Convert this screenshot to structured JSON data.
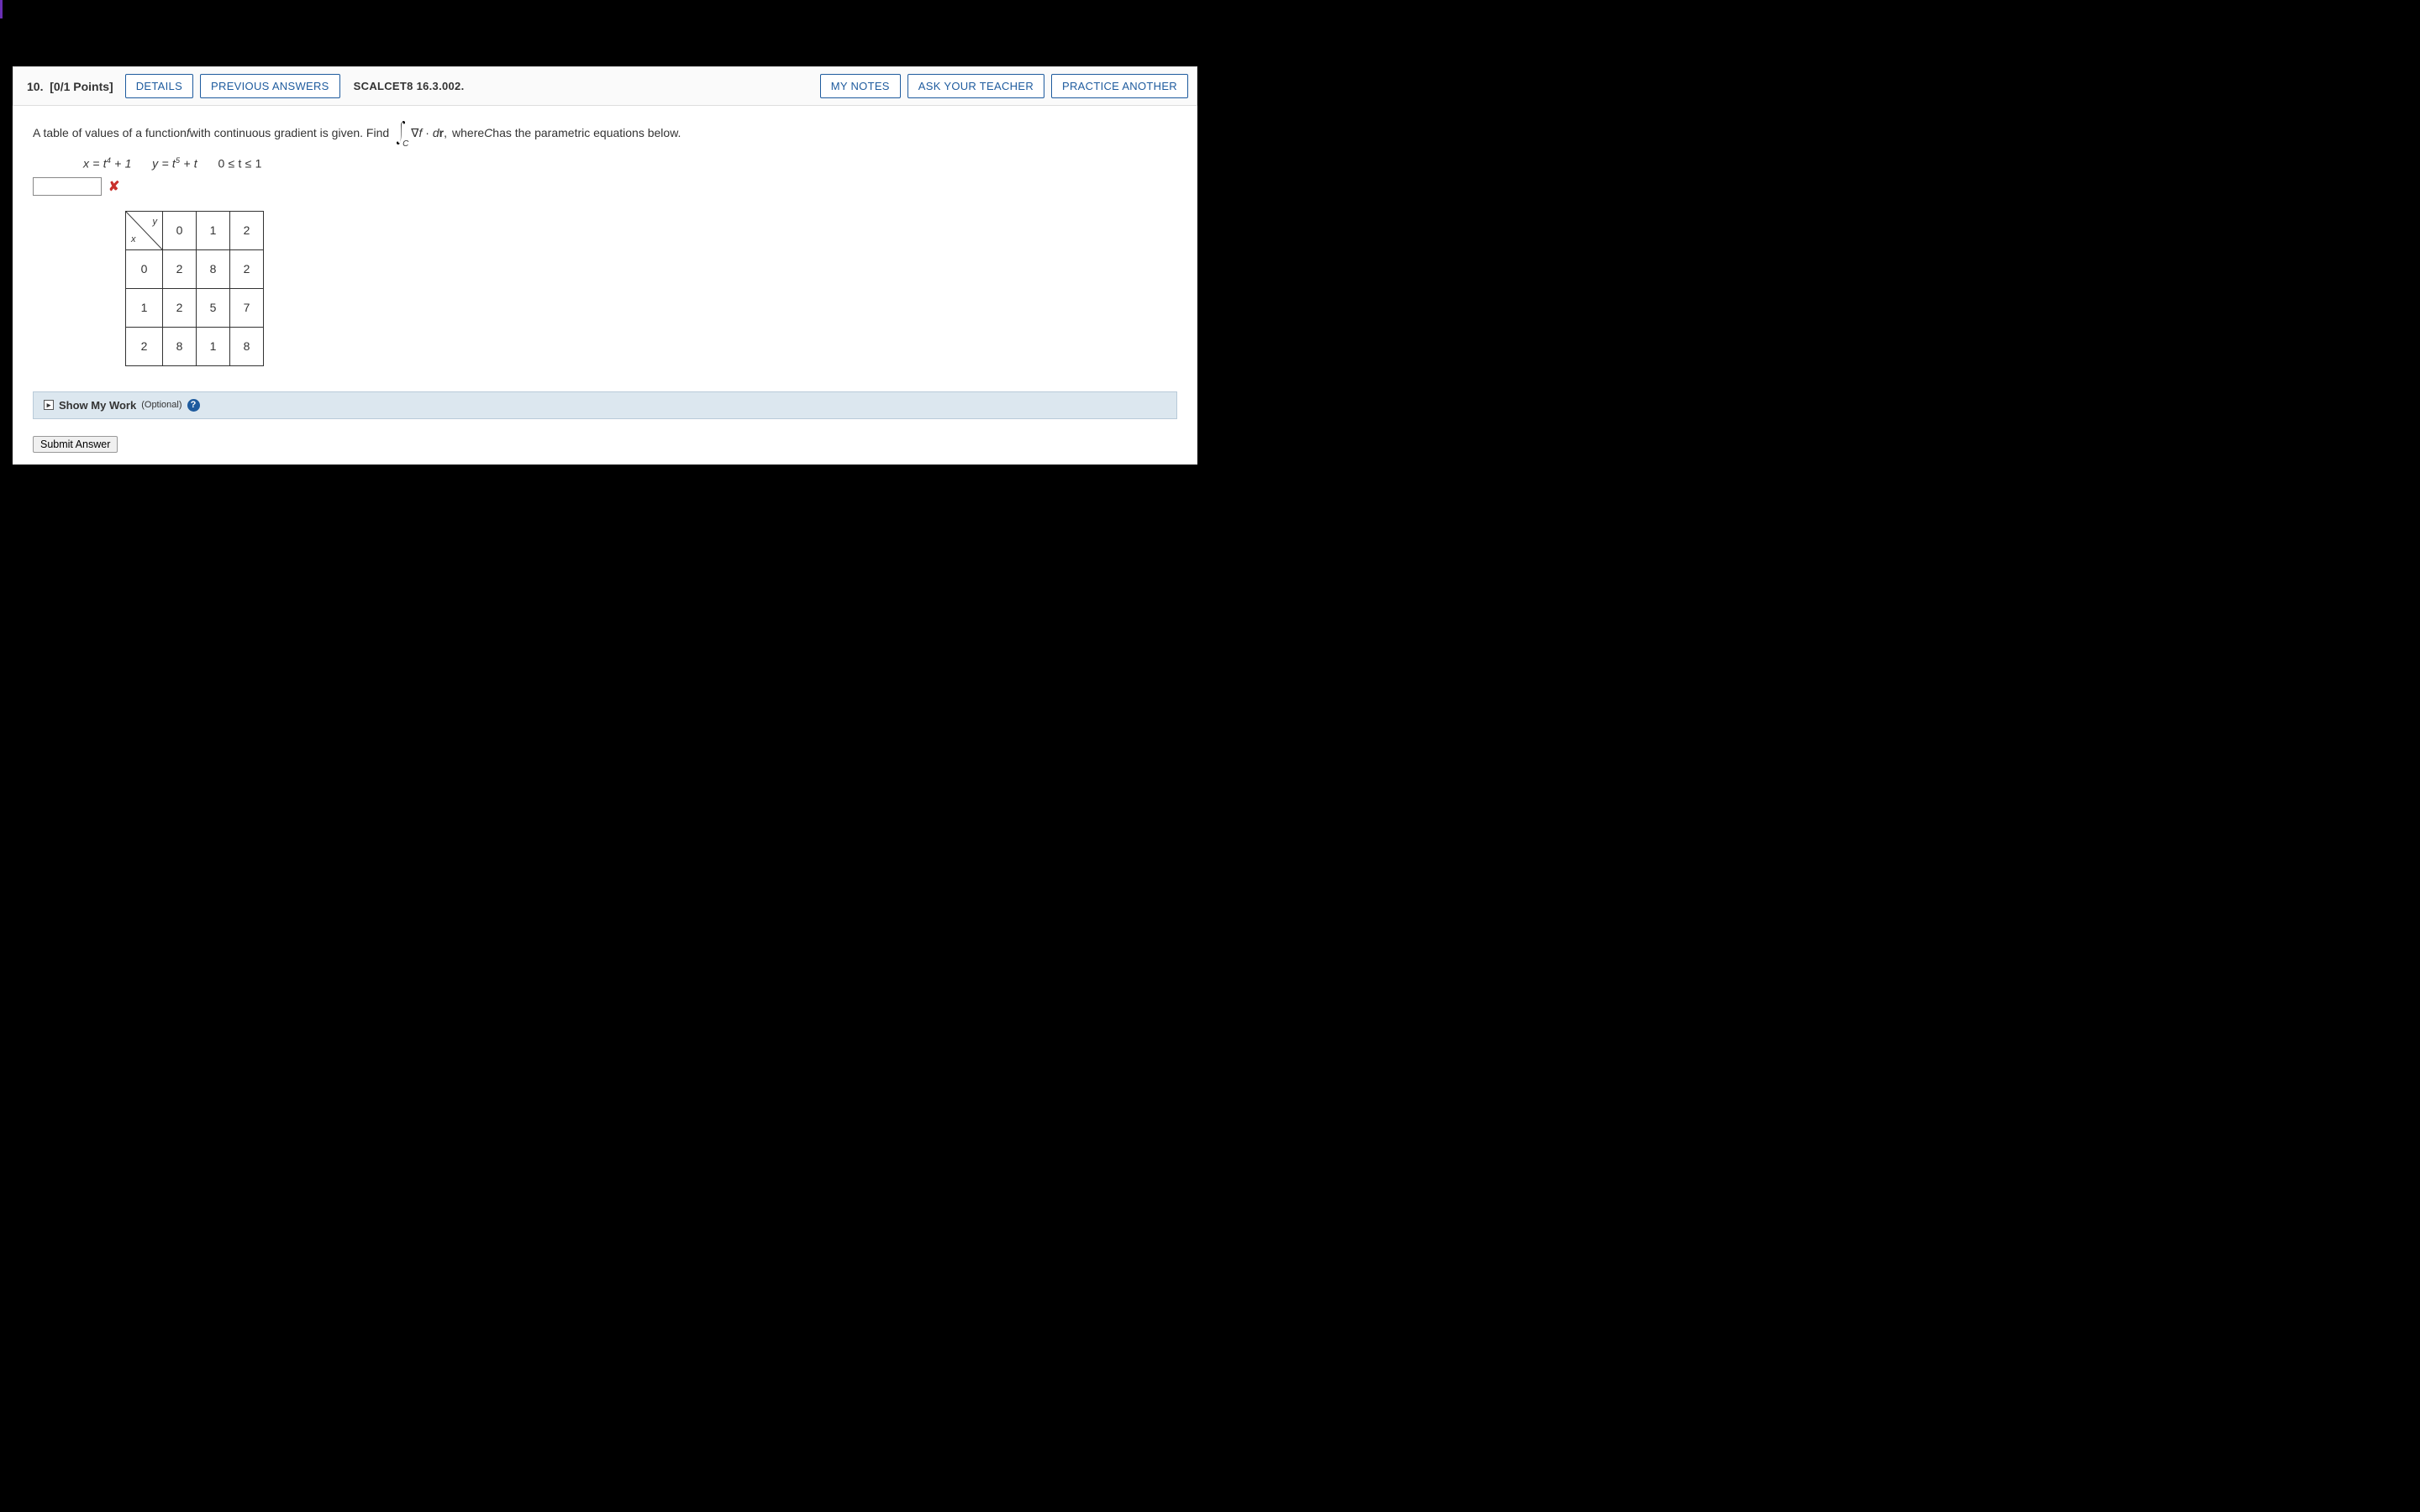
{
  "header": {
    "question_number": "10.",
    "points": "[0/1 Points]",
    "details_btn": "DETAILS",
    "prev_answers_btn": "PREVIOUS ANSWERS",
    "source": "SCALCET8 16.3.002.",
    "my_notes_btn": "MY NOTES",
    "ask_teacher_btn": "ASK YOUR TEACHER",
    "practice_another_btn": "PRACTICE ANOTHER"
  },
  "problem": {
    "intro_a": "A table of values of a function ",
    "f": "f",
    "intro_b": " with continuous gradient is given. Find ",
    "integral_sub": "C",
    "integrand": "∇f · dr,",
    "intro_c": "  where ",
    "c_var": "C",
    "intro_d": " has the parametric equations below.",
    "eq_x": "x = t",
    "eq_x_sup": "4",
    "eq_x_tail": " + 1",
    "eq_y": "y = t",
    "eq_y_sup": "5",
    "eq_y_tail": " + t",
    "eq_range": "0 ≤ t ≤ 1"
  },
  "answer": {
    "value": "",
    "wrong_mark": "✘"
  },
  "table": {
    "corner_x": "x",
    "corner_y": "y",
    "col_headers": [
      "0",
      "1",
      "2"
    ],
    "rows": [
      {
        "label": "0",
        "cells": [
          "2",
          "8",
          "2"
        ]
      },
      {
        "label": "1",
        "cells": [
          "2",
          "5",
          "7"
        ]
      },
      {
        "label": "2",
        "cells": [
          "8",
          "1",
          "8"
        ]
      }
    ]
  },
  "show_work": {
    "expand_glyph": "▸",
    "label": "Show My Work",
    "optional": "(Optional)",
    "help_glyph": "?"
  },
  "submit": {
    "label": "Submit Answer"
  }
}
